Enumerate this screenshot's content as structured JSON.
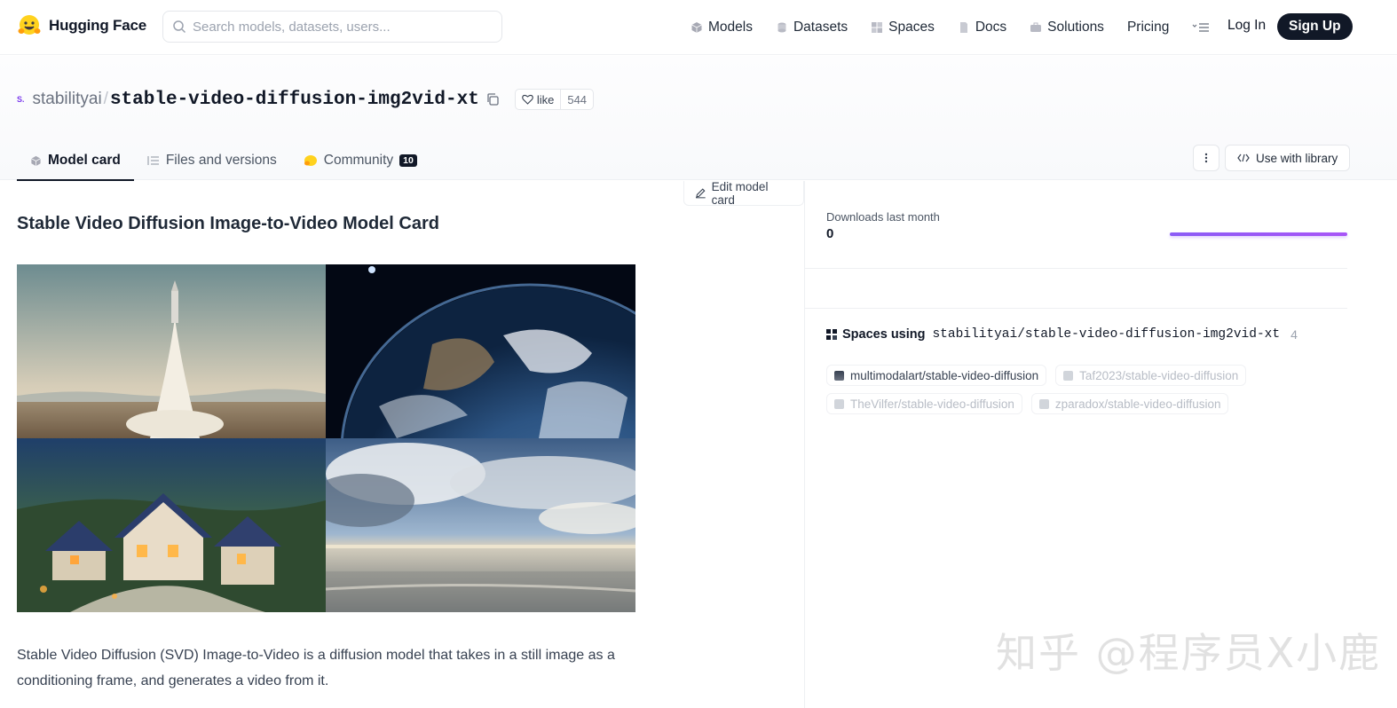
{
  "brand": {
    "name": "Hugging Face"
  },
  "search": {
    "placeholder": "Search models, datasets, users..."
  },
  "nav": {
    "links": [
      "Models",
      "Datasets",
      "Spaces",
      "Docs",
      "Solutions",
      "Pricing"
    ],
    "login": "Log In",
    "signup": "Sign Up"
  },
  "repo": {
    "org": "stabilityai",
    "separator": "/",
    "name": "stable-video-diffusion-img2vid-xt",
    "org_avatar": "S.",
    "like_label": "like",
    "like_count": "544"
  },
  "tabs": {
    "model_card": "Model card",
    "files": "Files and versions",
    "community": "Community",
    "community_count": "10"
  },
  "actions": {
    "use_with_library": "Use with library",
    "edit_model_card": "Edit model card"
  },
  "card": {
    "title": "Stable Video Diffusion Image-to-Video Model Card",
    "description": "Stable Video Diffusion (SVD) Image-to-Video is a diffusion model that takes in a still image as a conditioning frame, and generates a video from it."
  },
  "sidebar": {
    "downloads_label": "Downloads last month",
    "downloads_value": "0",
    "spaces_label": "Spaces using",
    "spaces_repo": "stabilityai/stable-video-diffusion-img2vid-xt",
    "spaces_count": "4",
    "spaces": [
      "multimodalart/stable-video-diffusion",
      "Taf2023/stable-video-diffusion",
      "TheVilfer/stable-video-diffusion",
      "zparadox/stable-video-diffusion"
    ]
  },
  "watermark": "知乎 @程序员X小鹿",
  "colors": {
    "accent": "#8b5cf6",
    "dark": "#111827",
    "muted": "#6b7280"
  }
}
